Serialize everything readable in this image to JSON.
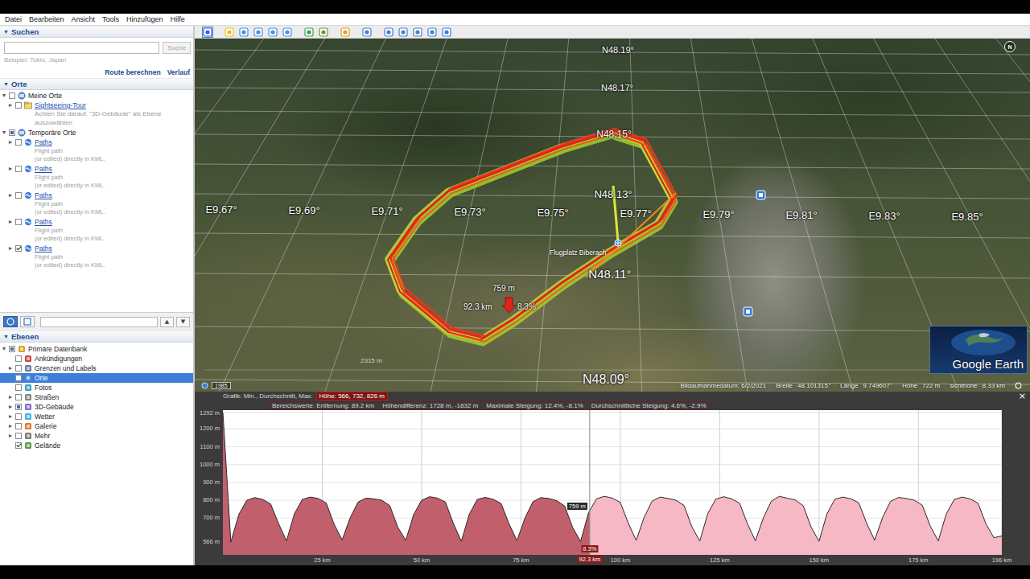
{
  "window": {
    "menu": [
      "Datei",
      "Bearbeiten",
      "Ansicht",
      "Tools",
      "Hinzufügen",
      "Hilfe"
    ]
  },
  "sidebar": {
    "search": {
      "arrow": "▼",
      "title": "Suchen",
      "button": "Suche",
      "hint": "Beispiel: Tokio, Japan",
      "links": [
        "Route berechnen",
        "Verlauf"
      ]
    },
    "places": {
      "arrow": "▼",
      "title": "Orte",
      "items": [
        {
          "kind": "folder",
          "depth": 0,
          "arrow": "▾",
          "label": "Meine Orte",
          "checked": false,
          "partial": false
        },
        {
          "kind": "link",
          "depth": 1,
          "arrow": "▸",
          "label": "Sightseeing-Tour",
          "checked": false,
          "partial": false
        },
        {
          "kind": "note",
          "depth": 1,
          "lines": [
            "Achten Sie darauf, \"3D-Gebäude\" als Ebene",
            "auszuwählen"
          ]
        },
        {
          "kind": "folder",
          "depth": 0,
          "arrow": "▾",
          "label": "Temporäre Orte",
          "checked": false,
          "partial": true
        },
        {
          "kind": "path",
          "depth": 1,
          "arrow": "▸",
          "label": "Paths",
          "lines": [
            "Flight path",
            "(or edited) directly in KML."
          ],
          "checked": false,
          "partial": false
        },
        {
          "kind": "path",
          "depth": 1,
          "arrow": "▸",
          "label": "Paths",
          "lines": [
            "Flight path",
            "(or edited) directly in KML."
          ],
          "checked": false,
          "partial": false
        },
        {
          "kind": "path",
          "depth": 1,
          "arrow": "▸",
          "label": "Paths",
          "lines": [
            "Flight path",
            "(or edited) directly in KML."
          ],
          "checked": false,
          "partial": false
        },
        {
          "kind": "path",
          "depth": 1,
          "arrow": "▸",
          "label": "Paths",
          "lines": [
            "Flight path",
            "(or edited) directly in KML."
          ],
          "checked": false,
          "partial": false
        },
        {
          "kind": "path",
          "depth": 1,
          "arrow": "▸",
          "label": "Paths",
          "lines": [
            "Flight path",
            "(or edited) directly in KML."
          ],
          "checked": true,
          "partial": false
        }
      ]
    },
    "places_toolbar": {
      "buttons": [
        {
          "selected": true
        },
        {
          "selected": false
        }
      ],
      "arrows": [
        "▲",
        "▼"
      ]
    },
    "layers": {
      "arrow": "▼",
      "title": "Ebenen",
      "items": [
        {
          "label": "Primäre Datenbank",
          "depth": 0,
          "arrow": "▾",
          "checked": false,
          "partial": true,
          "selected": false
        },
        {
          "label": "Ankündigungen",
          "depth": 1,
          "checked": false,
          "partial": false,
          "selected": false
        },
        {
          "label": "Grenzen und Labels",
          "depth": 1,
          "arrow": "▸",
          "checked": false,
          "partial": false,
          "selected": false
        },
        {
          "label": "Orte",
          "depth": 1,
          "checked": false,
          "partial": false,
          "selected": true
        },
        {
          "label": "Fotos",
          "depth": 1,
          "checked": false,
          "partial": false,
          "selected": false
        },
        {
          "label": "Straßen",
          "depth": 1,
          "arrow": "▸",
          "checked": false,
          "partial": false,
          "selected": false
        },
        {
          "label": "3D-Gebäude",
          "depth": 1,
          "arrow": "▸",
          "checked": false,
          "partial": true,
          "selected": false
        },
        {
          "label": "Wetter",
          "depth": 1,
          "arrow": "▸",
          "checked": false,
          "partial": false,
          "selected": false
        },
        {
          "label": "Galerie",
          "depth": 1,
          "arrow": "▸",
          "checked": false,
          "partial": false,
          "selected": false
        },
        {
          "label": "Mehr",
          "depth": 1,
          "arrow": "▸",
          "checked": false,
          "partial": false,
          "selected": false
        },
        {
          "label": "Gelände",
          "depth": 1,
          "checked": true,
          "partial": false,
          "selected": false
        }
      ]
    }
  },
  "toolbar": {
    "buttons": [
      {
        "selected": true
      },
      {
        "selected": false
      },
      {
        "selected": false
      },
      {
        "selected": false
      },
      {
        "selected": false
      },
      {
        "selected": false
      },
      {
        "selected": false
      },
      {
        "selected": false
      },
      {
        "selected": false
      },
      {
        "selected": false
      },
      {
        "selected": false
      },
      {
        "selected": false
      },
      {
        "selected": false
      },
      {
        "selected": false
      },
      {
        "selected": false
      }
    ]
  },
  "map": {
    "lat_labels": [
      "N48.19°",
      "N48.17°",
      "N48.15°",
      "N48.13°",
      "N48.11°",
      "N48.09°"
    ],
    "lon_labels": [
      "E9.67°",
      "E9.69°",
      "E9.71°",
      "E9.73°",
      "E9.75°",
      "E9.77°",
      "E9.79°",
      "E9.81°",
      "E9.83°",
      "E9.85°"
    ],
    "airfield": "Flugplatz Biberach",
    "marker": {
      "value": "759 m",
      "distance": "92.3 km",
      "grade": "8.3%"
    },
    "scale": "2315 m",
    "year": "1985",
    "compass": "N",
    "logo": "Google Earth",
    "status": {
      "date": "Bildaufnahmedatum: 6/2/2021",
      "fields": [
        {
          "label": "Breite",
          "value": "48.101315°"
        },
        {
          "label": "Länge",
          "value": "9.749607°"
        },
        {
          "label": "Höhe",
          "value": "722 m"
        },
        {
          "label": "sichthöhe",
          "value": "8.33 km"
        }
      ]
    }
  },
  "profile": {
    "legend": "Grafik: Min., Durchschnitt, Max:",
    "highlight": "Höhe: 566, 732, 826 m",
    "stats": [
      "Bereichswerte: Entfernung: 89.2 km",
      "Höhendifferenz: 1728 m, -1832 m",
      "Maximale Steigung: 12.4%, -8.1%",
      "Durchschnittliche Steigung: 4.6%, -2.9%"
    ],
    "close": "×",
    "y_ticks": [
      "1292 m",
      "1200 m",
      "1100 m",
      "1000 m",
      "900 m",
      "800 m",
      "700 m",
      "566 m"
    ],
    "x_ticks": [
      "25 km",
      "50 km",
      "75 km",
      "100 km",
      "125 km",
      "150 km",
      "175 km",
      "196 km"
    ],
    "series": [
      {
        "values": [
          1292,
          566,
          720,
          800,
          815,
          805,
          780,
          670,
          572,
          725,
          805,
          818,
          810,
          785,
          665,
          578,
          700,
          790,
          812,
          808,
          800,
          770,
          650,
          575,
          720,
          800,
          820,
          812,
          790,
          670,
          570,
          722,
          805,
          816,
          806,
          782,
          668,
          574,
          700,
          792,
          815,
          810,
          798,
          768,
          648,
          569,
          730,
          808,
          822,
          812,
          788,
          672,
          575,
          705,
          795,
          818,
          810,
          800,
          772,
          652,
          571,
          725,
          806,
          820,
          808,
          784,
          668,
          573,
          702,
          795,
          822,
          812,
          802,
          770,
          650,
          570,
          724,
          806,
          818,
          808,
          786,
          670,
          576,
          704,
          794,
          816,
          810,
          800,
          772,
          655,
          572,
          722,
          804,
          818,
          808,
          784,
          668,
          590,
          600
        ]
      }
    ],
    "cursor": {
      "distance": "92.3 km",
      "value": "759 m",
      "grade": "8.3%"
    }
  }
}
